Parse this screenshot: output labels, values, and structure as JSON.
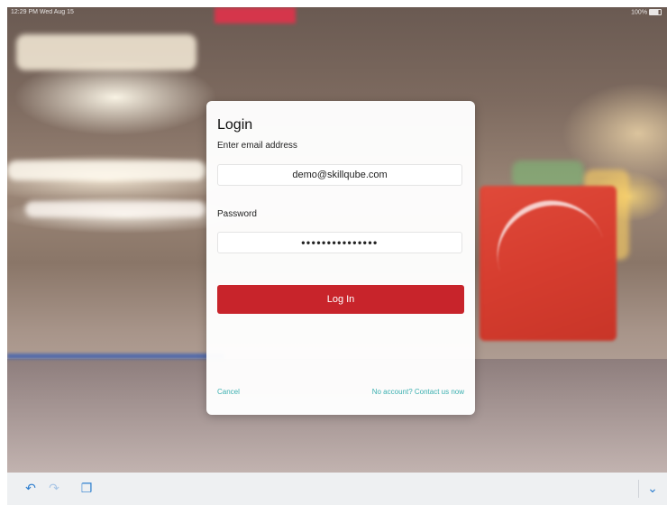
{
  "status_bar": {
    "time": "12:29 PM  Wed Aug 15",
    "battery": "100%"
  },
  "login": {
    "title": "Login",
    "email_label": "Enter email address",
    "email_value": "demo@skillqube.com",
    "password_label": "Password",
    "password_value": "•••••••••••••••",
    "login_button": "Log In",
    "cancel": "Cancel",
    "contact": "No account? Contact us now"
  },
  "toolbar": {
    "undo_icon": "↶",
    "redo_icon": "↷",
    "paste_icon": "❐",
    "chevron_icon": "⌄"
  },
  "colors": {
    "accent": "#c8242b",
    "link": "#3bb0b0",
    "toolbar_icon": "#2f7fcf"
  }
}
